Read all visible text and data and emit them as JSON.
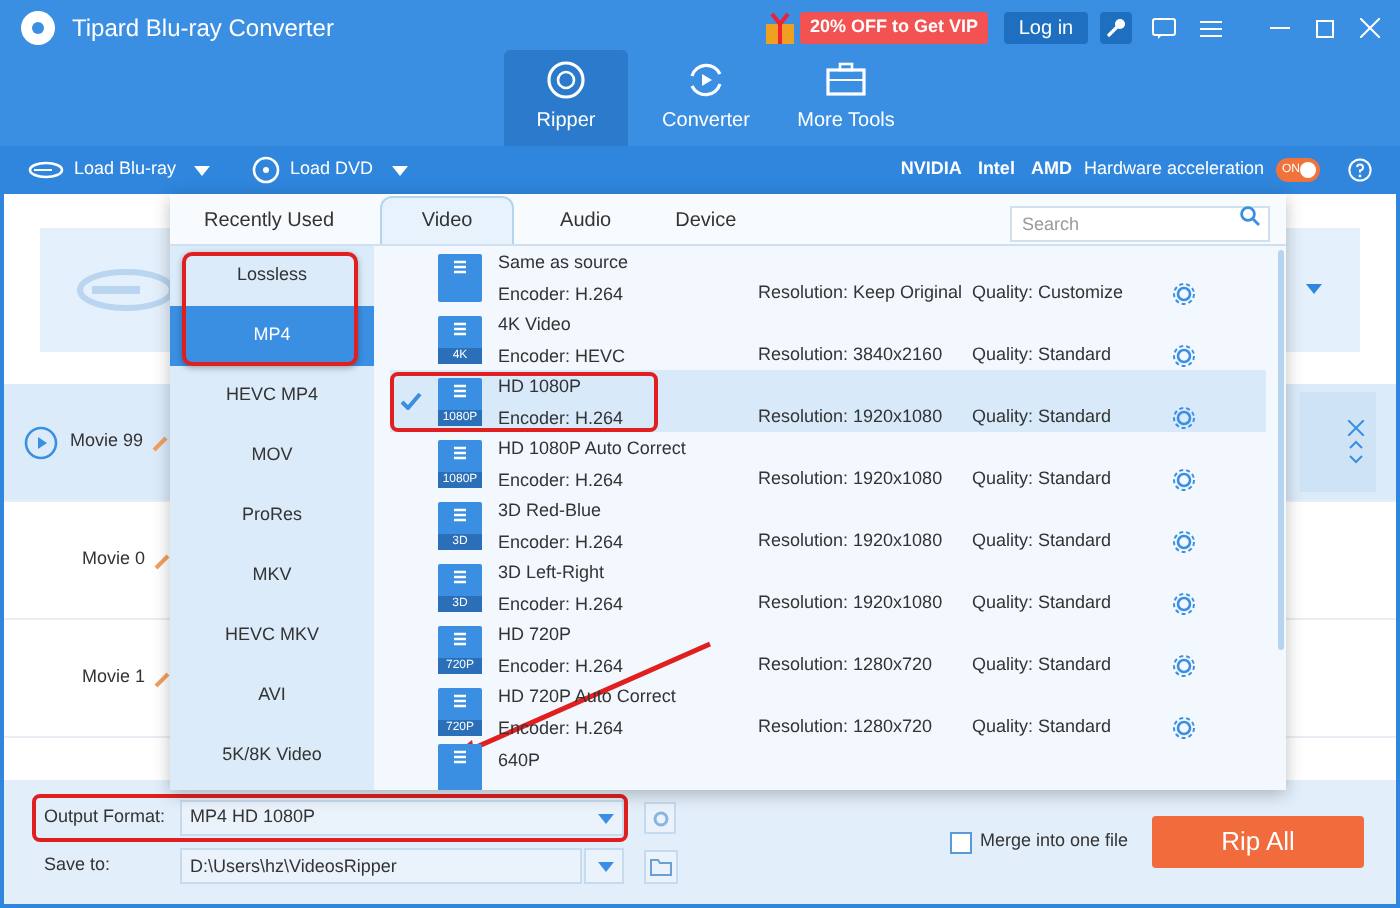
{
  "window": {
    "title": "Tipard Blu-ray Converter"
  },
  "header": {
    "promo": "20% OFF to Get VIP",
    "login": "Log in"
  },
  "nav_tabs": [
    {
      "label": "Ripper",
      "selected": true
    },
    {
      "label": "Converter",
      "selected": false
    },
    {
      "label": "More Tools",
      "selected": false
    }
  ],
  "toolbar": {
    "load_buttons": [
      "Load Blu-ray",
      "Load DVD"
    ],
    "gpu_brands": [
      "NVIDIA",
      "Intel",
      "AMD"
    ],
    "acceleration_label": "Hardware acceleration",
    "toggle": {
      "label": "ON",
      "on": true
    }
  },
  "movies": [
    {
      "title": "Movie 99",
      "selected": true
    },
    {
      "title": "Movie 0",
      "selected": false
    },
    {
      "title": "Movie 1",
      "selected": false
    }
  ],
  "format_popup": {
    "tabs": [
      {
        "label": "Recently Used",
        "selected": false
      },
      {
        "label": "Video",
        "selected": true
      },
      {
        "label": "Audio",
        "selected": false
      },
      {
        "label": "Device",
        "selected": false
      }
    ],
    "search": {
      "placeholder": "Search"
    },
    "categories": [
      {
        "label": "Lossless",
        "selected": false
      },
      {
        "label": "MP4",
        "selected": true
      },
      {
        "label": "HEVC MP4",
        "selected": false
      },
      {
        "label": "MOV",
        "selected": false
      },
      {
        "label": "ProRes",
        "selected": false
      },
      {
        "label": "MKV",
        "selected": false
      },
      {
        "label": "HEVC MKV",
        "selected": false
      },
      {
        "label": "AVI",
        "selected": false
      },
      {
        "label": "5K/8K Video",
        "selected": false
      }
    ],
    "formats": [
      {
        "name": "Same as source",
        "encoder": "Encoder: H.264",
        "resolution": "Resolution: Keep Original",
        "quality": "Quality: Customize",
        "selected": false
      },
      {
        "name": "4K Video",
        "badge": "4K",
        "encoder": "Encoder: HEVC",
        "resolution": "Resolution: 3840x2160",
        "quality": "Quality: Standard",
        "selected": false
      },
      {
        "name": "HD 1080P",
        "badge": "1080P",
        "encoder": "Encoder: H.264",
        "resolution": "Resolution: 1920x1080",
        "quality": "Quality: Standard",
        "selected": true
      },
      {
        "name": "HD 1080P Auto Correct",
        "badge": "1080P",
        "encoder": "Encoder: H.264",
        "resolution": "Resolution: 1920x1080",
        "quality": "Quality: Standard",
        "selected": false
      },
      {
        "name": "3D Red-Blue",
        "badge": "3D",
        "encoder": "Encoder: H.264",
        "resolution": "Resolution: 1920x1080",
        "quality": "Quality: Standard",
        "selected": false
      },
      {
        "name": "3D Left-Right",
        "badge": "3D",
        "encoder": "Encoder: H.264",
        "resolution": "Resolution: 1920x1080",
        "quality": "Quality: Standard",
        "selected": false
      },
      {
        "name": "HD 720P",
        "badge": "720P",
        "encoder": "Encoder: H.264",
        "resolution": "Resolution: 1280x720",
        "quality": "Quality: Standard",
        "selected": false
      },
      {
        "name": "HD 720P Auto Correct",
        "badge": "720P",
        "encoder": "Encoder: H.264",
        "resolution": "Resolution: 1280x720",
        "quality": "Quality: Standard",
        "selected": false
      },
      {
        "name": "640P",
        "selected": false
      }
    ]
  },
  "bottom": {
    "output_format": {
      "label": "Output Format:",
      "value": "MP4 HD 1080P"
    },
    "save_to": {
      "label": "Save to:",
      "value": "D:\\Users\\hz\\VideosRipper"
    },
    "merge": {
      "label": "Merge into one file",
      "checked": false
    },
    "rip_button": "Rip All"
  }
}
